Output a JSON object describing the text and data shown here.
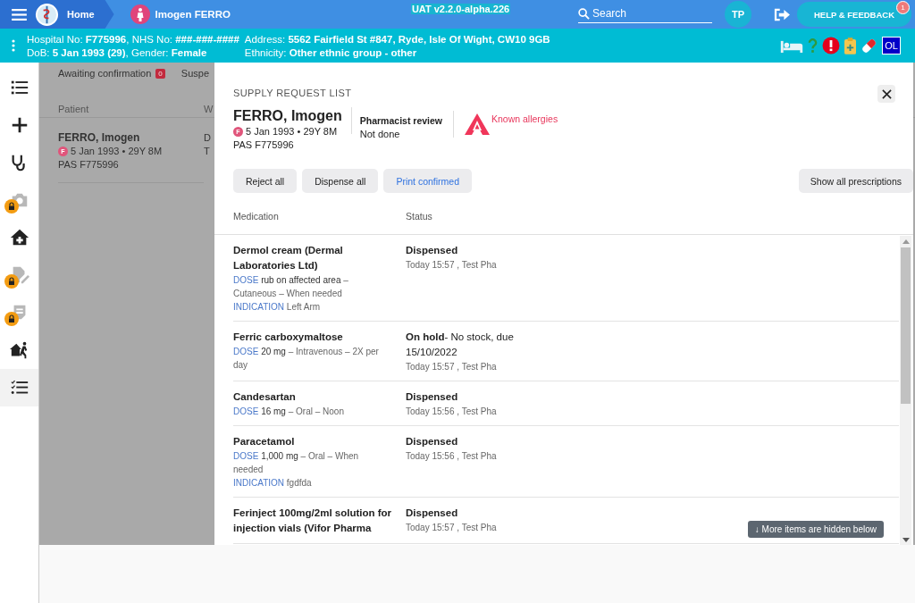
{
  "top_bar": {
    "home": "Home",
    "patient": "Imogen FERRO",
    "version": "UAT v2.2.0-alpha.226",
    "search": {
      "placeholder": "Search"
    },
    "user": "TP",
    "help": "HELP & FEEDBACK",
    "help_badge": "1"
  },
  "patient_banner": {
    "left": [
      "Hospital No: **F775996**, NHS No: **###-###-####**",
      "DoB: **5 Jan 1993 (29)**, Gender: **Female**"
    ],
    "right": [
      "Address: **5562 Fairfield St #847, Ryde, Isle Of Wight, CW10 9GB**",
      "Ethnicity: **Other ethnic group - other**"
    ],
    "badge": "OL"
  },
  "sidebar": {
    "items": [
      {
        "locked": false,
        "selected": false
      },
      {
        "locked": false,
        "selected": false
      },
      {
        "locked": false,
        "selected": false
      },
      {
        "locked": true,
        "selected": false
      },
      {
        "locked": false,
        "selected": false
      },
      {
        "locked": true,
        "selected": false
      },
      {
        "locked": true,
        "selected": false
      },
      {
        "locked": false,
        "selected": false
      },
      {
        "locked": false,
        "selected": true
      }
    ]
  },
  "background_page": {
    "tabs": [
      {
        "label": "Awaiting confirmation",
        "count": "0"
      },
      {
        "label": "Suspe"
      }
    ],
    "columns": [
      "Patient",
      "W"
    ],
    "rows": [
      {
        "name": "FERRO, Imogen",
        "gender": "F",
        "dob": "5 Jan 1993 • 29Y 8M",
        "pas": "PAS F775996",
        "column_2": [
          "D",
          "T"
        ]
      }
    ]
  },
  "dialog": {
    "title": "SUPPLY REQUEST LIST",
    "patient": {
      "name": "FERRO, Imogen",
      "gender": "F",
      "dob": "5 Jan 1993 • 29Y 8M",
      "pas": "PAS F775996"
    },
    "review": {
      "label": "Pharmacist review",
      "value": "Not done"
    },
    "allergy": "Known allergies",
    "buttons": [
      {
        "label": "Reject all",
        "kind": "plain"
      },
      {
        "label": "Dispense all",
        "kind": "plain"
      },
      {
        "label": "Print confirmed",
        "kind": "link"
      }
    ],
    "show_all": "Show all prescriptions",
    "columns": [
      "Medication",
      "Status"
    ],
    "items": [
      {
        "name": "Dermol cream (Dermal Laboratories Ltd)",
        "dose_label": "DOSE",
        "dose": "rub on affected area",
        "dose_rest": "– Cutaneous – When needed",
        "indication_label": "INDICATION",
        "indication": "Left Arm",
        "status": "Dispensed",
        "time": "Today 15:57 , Test Pha"
      },
      {
        "name": "Ferric carboxymaltose",
        "dose_label": "DOSE",
        "dose": "20 mg",
        "dose_rest": "– Intravenous – 2X per day",
        "status": "On hold",
        "status_note": "- No stock, due 15/10/2022",
        "time": "Today 15:57 , Test Pha"
      },
      {
        "name": "Candesartan",
        "dose_label": "DOSE",
        "dose": "16 mg",
        "dose_rest": "– Oral – Noon",
        "status": "Dispensed",
        "time": "Today 15:56 , Test Pha"
      },
      {
        "name": "Paracetamol",
        "dose_label": "DOSE",
        "dose": "1,000 mg",
        "dose_rest": "– Oral – When needed",
        "indication_label": "INDICATION",
        "indication": "fgdfda",
        "status": "Dispensed",
        "time": "Today 15:56 , Test Pha"
      },
      {
        "name": "Ferinject 100mg/2ml solution for injection vials (Vifor Pharma",
        "status": "Dispensed",
        "time": "Today 15:57 , Test Pha"
      }
    ],
    "hidden_notice": "↓ More items are hidden below"
  }
}
